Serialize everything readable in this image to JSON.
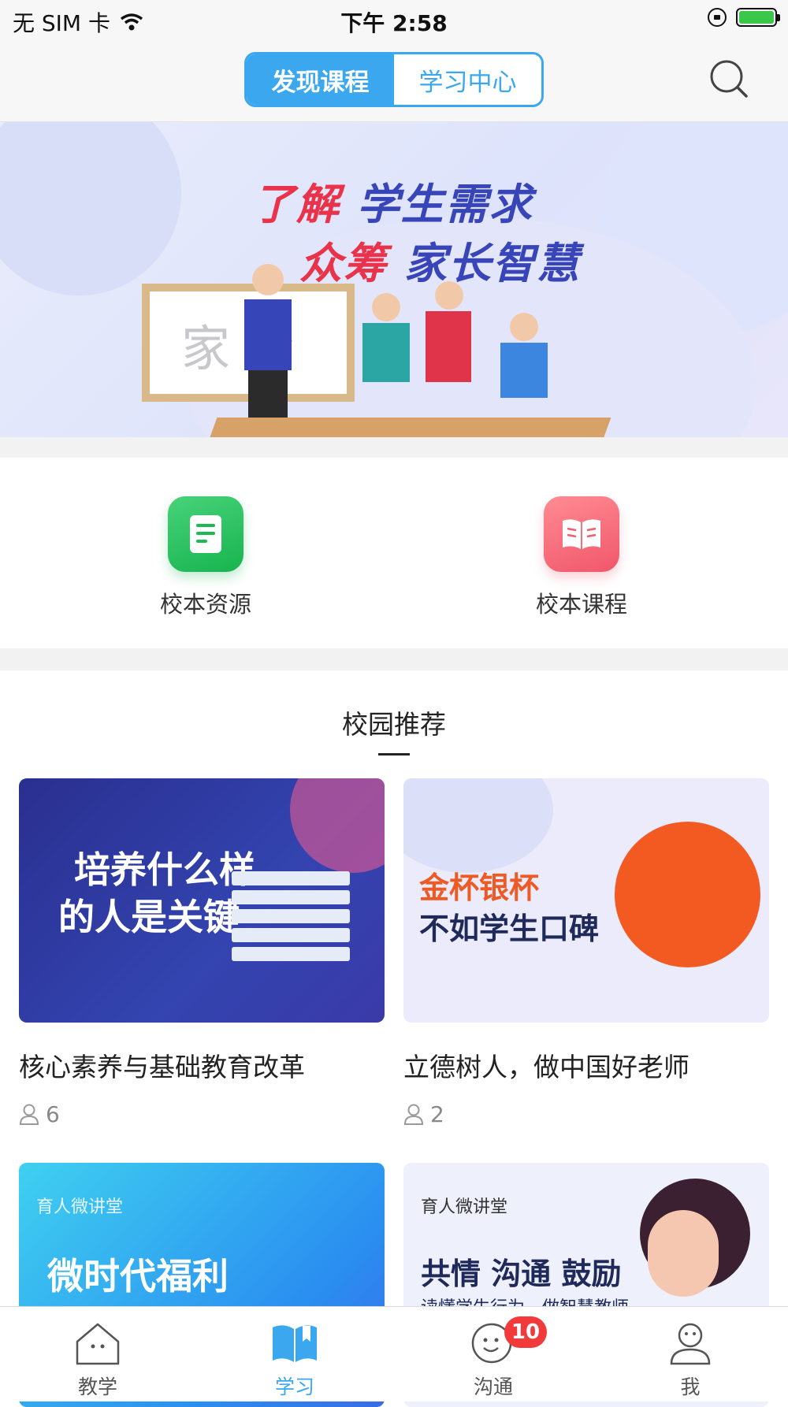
{
  "status_bar": {
    "carrier": "无 SIM 卡",
    "time": "下午 2:58"
  },
  "top_nav": {
    "tabs": [
      {
        "label": "发现课程",
        "active": true
      },
      {
        "label": "学习中心",
        "active": false
      }
    ],
    "search_icon": "search-icon"
  },
  "banner": {
    "line1_red": "了解",
    "line1_blue": "学生需求",
    "line2_red": "众筹",
    "line2_blue": "家长智慧",
    "board_text": "家 会"
  },
  "quick_entries": [
    {
      "label": "校本资源",
      "icon": "document-icon",
      "color": "#1fb954"
    },
    {
      "label": "校本课程",
      "icon": "open-book-icon",
      "color": "#f25c6e"
    }
  ],
  "section": {
    "title": "校园推荐"
  },
  "cards": [
    {
      "title": "核心素养与基础教育改革",
      "count": "6",
      "thumb_text_1": "培养什么样",
      "thumb_text_2": "的人是关键"
    },
    {
      "title": "立德树人，做中国好老师",
      "count": "2",
      "thumb_text_1": "金杯银杯",
      "thumb_text_2": "不如学生口碑"
    },
    {
      "title": "",
      "thumb_small": "育人微讲堂",
      "thumb_big": "微时代福利"
    },
    {
      "title": "",
      "thumb_small": "育人微讲堂",
      "thumb_big": "共情 沟通 鼓励",
      "thumb_sub": "读懂学生行为，做智慧教师"
    }
  ],
  "tab_bar": {
    "items": [
      {
        "label": "教学",
        "icon": "house-icon",
        "active": false
      },
      {
        "label": "学习",
        "icon": "book-icon",
        "active": true
      },
      {
        "label": "沟通",
        "icon": "chat-face-icon",
        "active": false,
        "badge": "10"
      },
      {
        "label": "我",
        "icon": "person-icon",
        "active": false
      }
    ],
    "active_color": "#3aa7ef",
    "inactive_color": "#555555"
  },
  "colors": {
    "accent": "#3aa7ef",
    "badge": "#f23a3a"
  }
}
